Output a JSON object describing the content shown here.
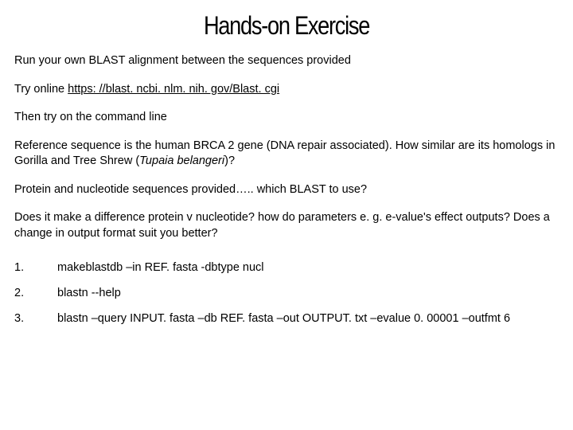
{
  "title": "Hands-on Exercise",
  "p1": "Run your own BLAST alignment between the sequences provided",
  "p2_prefix": "Try online ",
  "p2_link": "https: //blast. ncbi. nlm. nih. gov/Blast. cgi",
  "p3": "Then try on the command line",
  "p4_a": "Reference sequence is the human BRCA 2 gene (DNA repair associated). How similar are its homologs in Gorilla and Tree Shrew (",
  "p4_italic": "Tupaia belangeri",
  "p4_b": ")?",
  "p5": "Protein and nucleotide sequences provided….. which BLAST to use?",
  "p6": "Does it make a difference protein v nucleotide? how do parameters e. g. e-value's effect outputs? Does a change in output format suit you better?",
  "steps": {
    "0": {
      "num": "1.",
      "cmd": "makeblastdb –in REF. fasta -dbtype nucl"
    },
    "1": {
      "num": "2.",
      "cmd": "blastn --help"
    },
    "2": {
      "num": "3.",
      "cmd": "blastn  –query INPUT. fasta –db REF. fasta –out OUTPUT. txt –evalue 0. 00001 –outfmt 6"
    }
  }
}
